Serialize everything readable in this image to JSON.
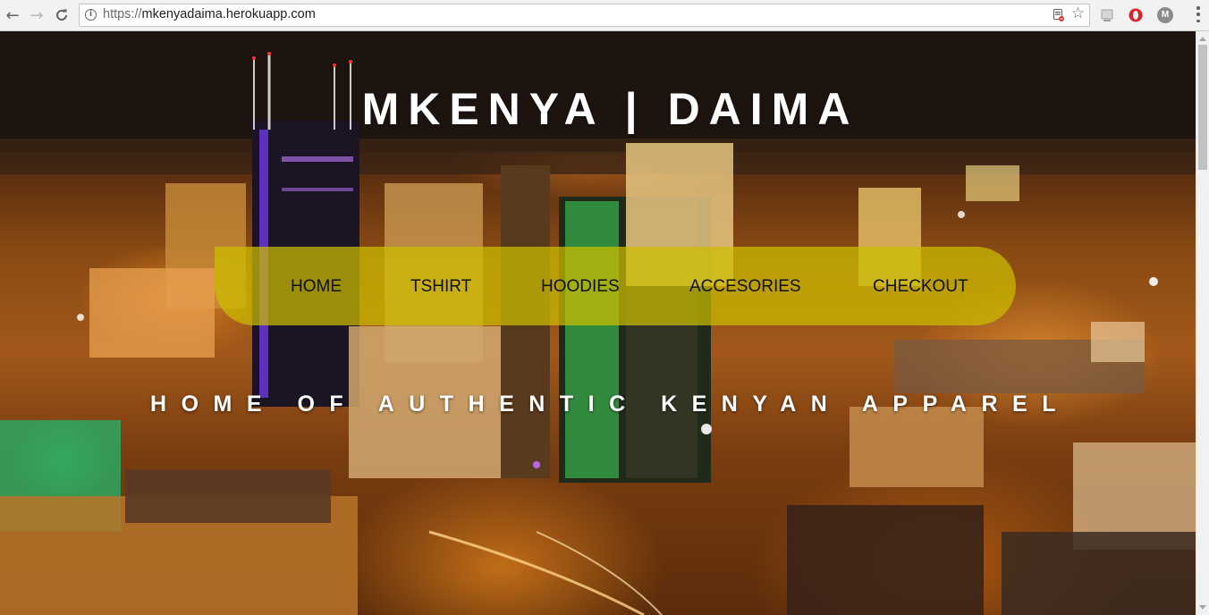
{
  "browser": {
    "url_scheme": "https://",
    "url_host": "mkenyadaima.herokuapp.com",
    "back_glyph": "←",
    "forward_glyph": "→",
    "reload_glyph": "C",
    "star_glyph": "☆",
    "info_glyph": "i",
    "extensions": [
      {
        "name": "extension-icon",
        "color": "#9e9e9e"
      },
      {
        "name": "opera-icon",
        "color": "#e0202a"
      },
      {
        "name": "m-extension-icon",
        "color": "#8d8d8d",
        "letter": "M"
      }
    ]
  },
  "site": {
    "title": "MKENYA | DAIMA",
    "tagline": "HOME OF AUTHENTIC KENYAN APPAREL",
    "nav": [
      {
        "label": "HOME"
      },
      {
        "label": "TSHIRT"
      },
      {
        "label": "HOODIES"
      },
      {
        "label": "ACCESORIES"
      },
      {
        "label": "CHECKOUT"
      }
    ],
    "colors": {
      "nav_background": "#ccbe00",
      "title_text": "#ffffff"
    }
  }
}
